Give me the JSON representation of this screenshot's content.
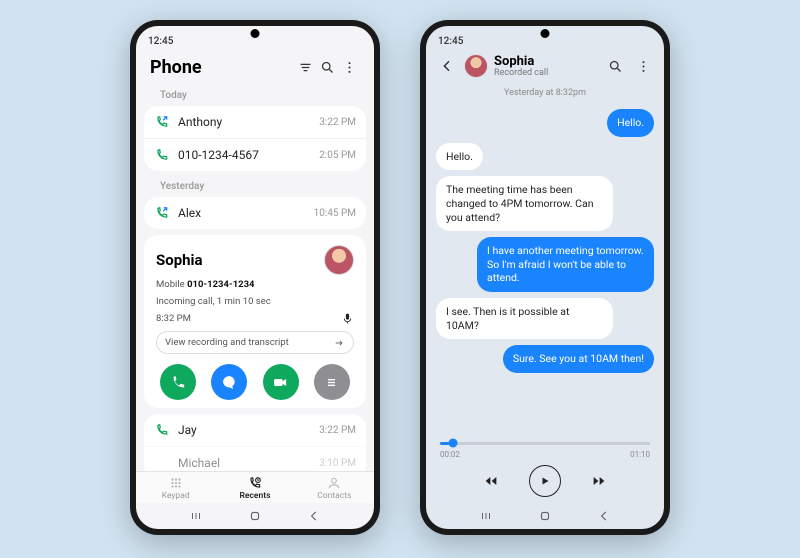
{
  "status": {
    "time": "12:45"
  },
  "phone1": {
    "title": "Phone",
    "sections": {
      "today": "Today",
      "yesterday": "Yesterday"
    },
    "calls": {
      "anthony": {
        "name": "Anthony",
        "time": "3:22 PM"
      },
      "num": {
        "name": "010-1234-4567",
        "time": "2:05 PM"
      },
      "alex": {
        "name": "Alex",
        "time": "10:45 PM"
      },
      "jay": {
        "name": "Jay",
        "time": "3:22 PM"
      },
      "michael": {
        "name": "Michael",
        "time": "3:10 PM"
      }
    },
    "detail": {
      "name": "Sophia",
      "line1a": "Mobile ",
      "line1b": "010-1234-1234",
      "line2": "Incoming call, 1 min 10 sec",
      "line3": "8:32 PM",
      "transcript_btn": "View recording and transcript"
    },
    "bottom": {
      "keypad": "Keypad",
      "recents": "Recents",
      "contacts": "Contacts"
    }
  },
  "phone2": {
    "name": "Sophia",
    "subtitle": "Recorded call",
    "daystamp": "Yesterday at 8:32pm",
    "messages": {
      "m1": "Hello.",
      "m2": "Hello.",
      "m3": "The meeting time has been changed to 4PM tomorrow. Can you attend?",
      "m4": "I have another meeting tomorrow. So I'm afraid I won't be able to attend.",
      "m5": "I see. Then is it possible at 10AM?",
      "m6": "Sure. See you at 10AM then!"
    },
    "player": {
      "current": "00:02",
      "total": "01:10"
    }
  }
}
